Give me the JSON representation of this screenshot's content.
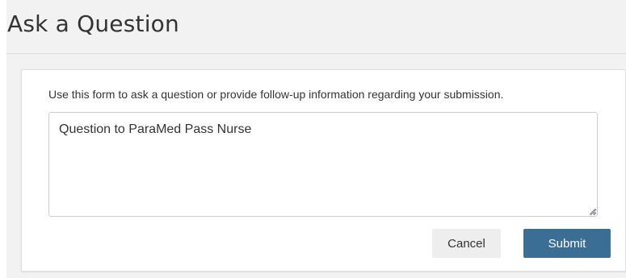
{
  "page": {
    "title": "Ask a Question"
  },
  "form": {
    "instructions": "Use this form to ask a question or provide follow-up information regarding your submission.",
    "question_value": "Question to ParaMed Pass Nurse",
    "cancel_label": "Cancel",
    "submit_label": "Submit"
  },
  "colors": {
    "primary_button": "#3b6e94",
    "secondary_button": "#eeeeee",
    "text": "#333333"
  }
}
